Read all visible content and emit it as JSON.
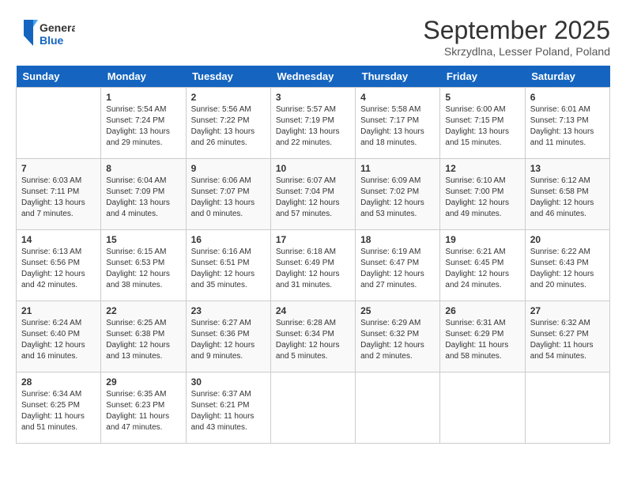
{
  "header": {
    "logo_general": "General",
    "logo_blue": "Blue",
    "month_title": "September 2025",
    "location": "Skrzydlna, Lesser Poland, Poland"
  },
  "days_of_week": [
    "Sunday",
    "Monday",
    "Tuesday",
    "Wednesday",
    "Thursday",
    "Friday",
    "Saturday"
  ],
  "weeks": [
    [
      {
        "day": "",
        "content": ""
      },
      {
        "day": "1",
        "content": "Sunrise: 5:54 AM\nSunset: 7:24 PM\nDaylight: 13 hours\nand 29 minutes."
      },
      {
        "day": "2",
        "content": "Sunrise: 5:56 AM\nSunset: 7:22 PM\nDaylight: 13 hours\nand 26 minutes."
      },
      {
        "day": "3",
        "content": "Sunrise: 5:57 AM\nSunset: 7:19 PM\nDaylight: 13 hours\nand 22 minutes."
      },
      {
        "day": "4",
        "content": "Sunrise: 5:58 AM\nSunset: 7:17 PM\nDaylight: 13 hours\nand 18 minutes."
      },
      {
        "day": "5",
        "content": "Sunrise: 6:00 AM\nSunset: 7:15 PM\nDaylight: 13 hours\nand 15 minutes."
      },
      {
        "day": "6",
        "content": "Sunrise: 6:01 AM\nSunset: 7:13 PM\nDaylight: 13 hours\nand 11 minutes."
      }
    ],
    [
      {
        "day": "7",
        "content": "Sunrise: 6:03 AM\nSunset: 7:11 PM\nDaylight: 13 hours\nand 7 minutes."
      },
      {
        "day": "8",
        "content": "Sunrise: 6:04 AM\nSunset: 7:09 PM\nDaylight: 13 hours\nand 4 minutes."
      },
      {
        "day": "9",
        "content": "Sunrise: 6:06 AM\nSunset: 7:07 PM\nDaylight: 13 hours\nand 0 minutes."
      },
      {
        "day": "10",
        "content": "Sunrise: 6:07 AM\nSunset: 7:04 PM\nDaylight: 12 hours\nand 57 minutes."
      },
      {
        "day": "11",
        "content": "Sunrise: 6:09 AM\nSunset: 7:02 PM\nDaylight: 12 hours\nand 53 minutes."
      },
      {
        "day": "12",
        "content": "Sunrise: 6:10 AM\nSunset: 7:00 PM\nDaylight: 12 hours\nand 49 minutes."
      },
      {
        "day": "13",
        "content": "Sunrise: 6:12 AM\nSunset: 6:58 PM\nDaylight: 12 hours\nand 46 minutes."
      }
    ],
    [
      {
        "day": "14",
        "content": "Sunrise: 6:13 AM\nSunset: 6:56 PM\nDaylight: 12 hours\nand 42 minutes."
      },
      {
        "day": "15",
        "content": "Sunrise: 6:15 AM\nSunset: 6:53 PM\nDaylight: 12 hours\nand 38 minutes."
      },
      {
        "day": "16",
        "content": "Sunrise: 6:16 AM\nSunset: 6:51 PM\nDaylight: 12 hours\nand 35 minutes."
      },
      {
        "day": "17",
        "content": "Sunrise: 6:18 AM\nSunset: 6:49 PM\nDaylight: 12 hours\nand 31 minutes."
      },
      {
        "day": "18",
        "content": "Sunrise: 6:19 AM\nSunset: 6:47 PM\nDaylight: 12 hours\nand 27 minutes."
      },
      {
        "day": "19",
        "content": "Sunrise: 6:21 AM\nSunset: 6:45 PM\nDaylight: 12 hours\nand 24 minutes."
      },
      {
        "day": "20",
        "content": "Sunrise: 6:22 AM\nSunset: 6:43 PM\nDaylight: 12 hours\nand 20 minutes."
      }
    ],
    [
      {
        "day": "21",
        "content": "Sunrise: 6:24 AM\nSunset: 6:40 PM\nDaylight: 12 hours\nand 16 minutes."
      },
      {
        "day": "22",
        "content": "Sunrise: 6:25 AM\nSunset: 6:38 PM\nDaylight: 12 hours\nand 13 minutes."
      },
      {
        "day": "23",
        "content": "Sunrise: 6:27 AM\nSunset: 6:36 PM\nDaylight: 12 hours\nand 9 minutes."
      },
      {
        "day": "24",
        "content": "Sunrise: 6:28 AM\nSunset: 6:34 PM\nDaylight: 12 hours\nand 5 minutes."
      },
      {
        "day": "25",
        "content": "Sunrise: 6:29 AM\nSunset: 6:32 PM\nDaylight: 12 hours\nand 2 minutes."
      },
      {
        "day": "26",
        "content": "Sunrise: 6:31 AM\nSunset: 6:29 PM\nDaylight: 11 hours\nand 58 minutes."
      },
      {
        "day": "27",
        "content": "Sunrise: 6:32 AM\nSunset: 6:27 PM\nDaylight: 11 hours\nand 54 minutes."
      }
    ],
    [
      {
        "day": "28",
        "content": "Sunrise: 6:34 AM\nSunset: 6:25 PM\nDaylight: 11 hours\nand 51 minutes."
      },
      {
        "day": "29",
        "content": "Sunrise: 6:35 AM\nSunset: 6:23 PM\nDaylight: 11 hours\nand 47 minutes."
      },
      {
        "day": "30",
        "content": "Sunrise: 6:37 AM\nSunset: 6:21 PM\nDaylight: 11 hours\nand 43 minutes."
      },
      {
        "day": "",
        "content": ""
      },
      {
        "day": "",
        "content": ""
      },
      {
        "day": "",
        "content": ""
      },
      {
        "day": "",
        "content": ""
      }
    ]
  ]
}
